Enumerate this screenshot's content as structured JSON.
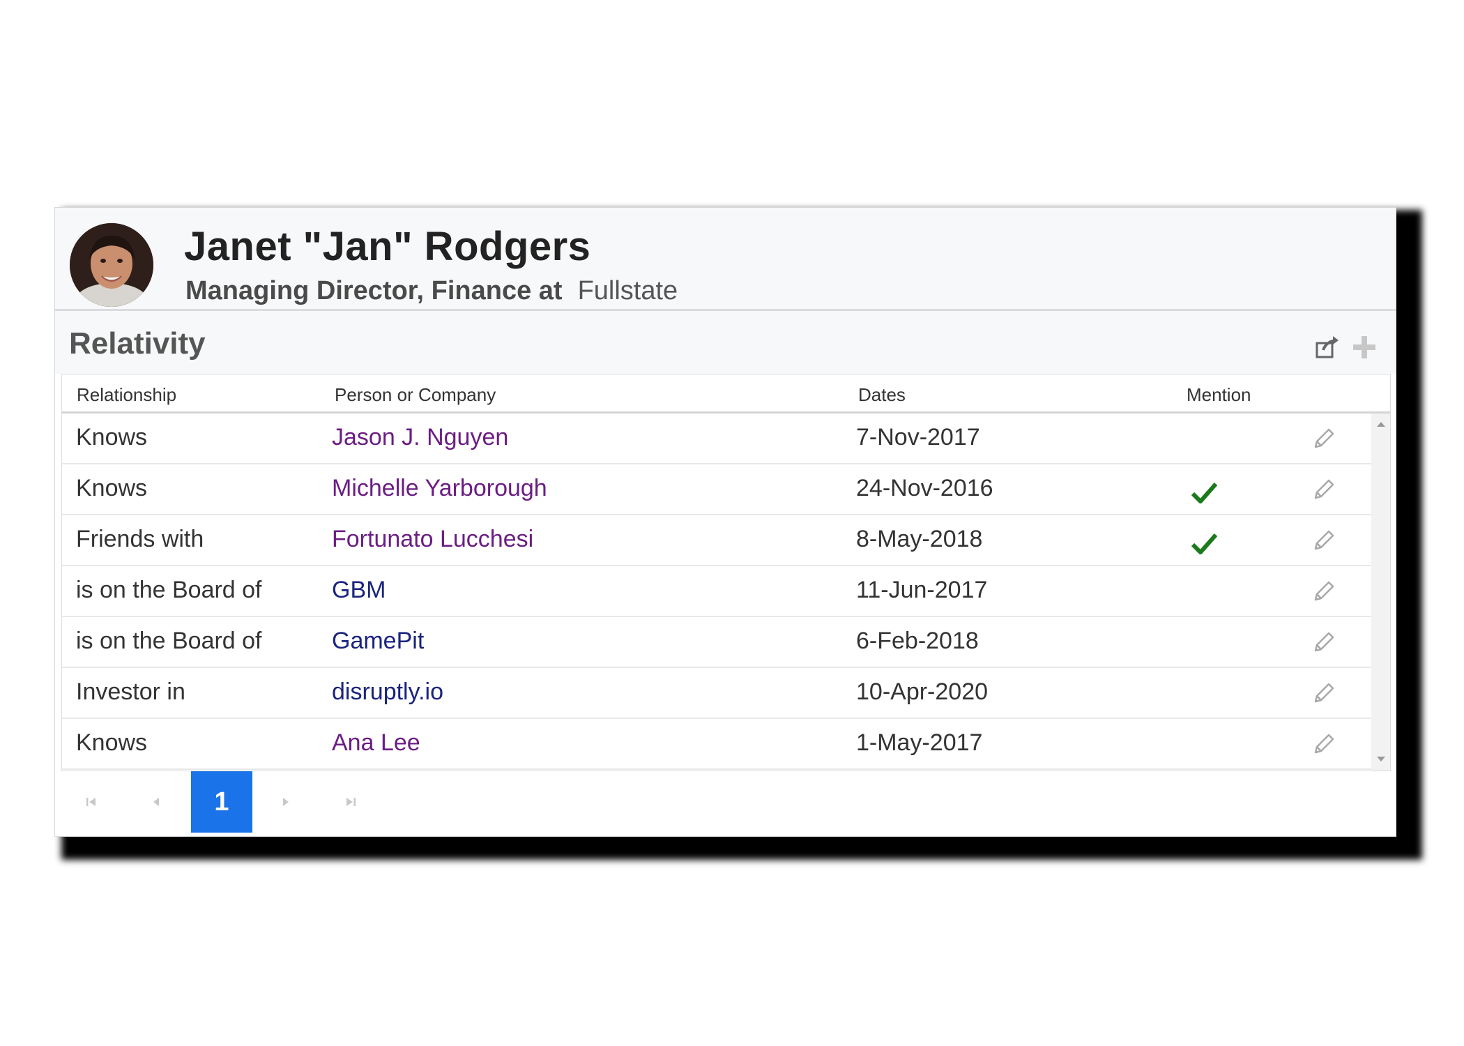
{
  "profile": {
    "name": "Janet \"Jan\" Rodgers",
    "role": "Managing Director, Finance at",
    "company": "Fullstate"
  },
  "section": {
    "title": "Relativity",
    "export_icon": "export-icon",
    "add_icon": "plus-icon"
  },
  "table": {
    "columns": [
      "Relationship",
      "Person or Company",
      "Dates",
      "Mention"
    ],
    "rows": [
      {
        "relationship": "Knows",
        "entity": "Jason J. Nguyen",
        "date": "7-Nov-2017",
        "mention": false
      },
      {
        "relationship": "Knows",
        "entity": "Michelle Yarborough",
        "date": "24-Nov-2016",
        "mention": true
      },
      {
        "relationship": "Friends with",
        "entity": "Fortunato Lucchesi",
        "date": "8-May-2018",
        "mention": true
      },
      {
        "relationship": "is on the Board of",
        "entity": "GBM",
        "date": "11-Jun-2017",
        "mention": false
      },
      {
        "relationship": "is on the Board of",
        "entity": "GamePit",
        "date": "6-Feb-2018",
        "mention": false
      },
      {
        "relationship": "Investor in",
        "entity": "disruptly.io",
        "date": "10-Apr-2020",
        "mention": false
      },
      {
        "relationship": "Knows",
        "entity": "Ana Lee",
        "date": "1-May-2017",
        "mention": false
      }
    ]
  },
  "pager": {
    "current_page": "1"
  },
  "colors": {
    "person_link": "#6b1d83",
    "company_link": "#1a237e",
    "check": "#1b7a1b",
    "pager_active": "#1a73e8"
  }
}
